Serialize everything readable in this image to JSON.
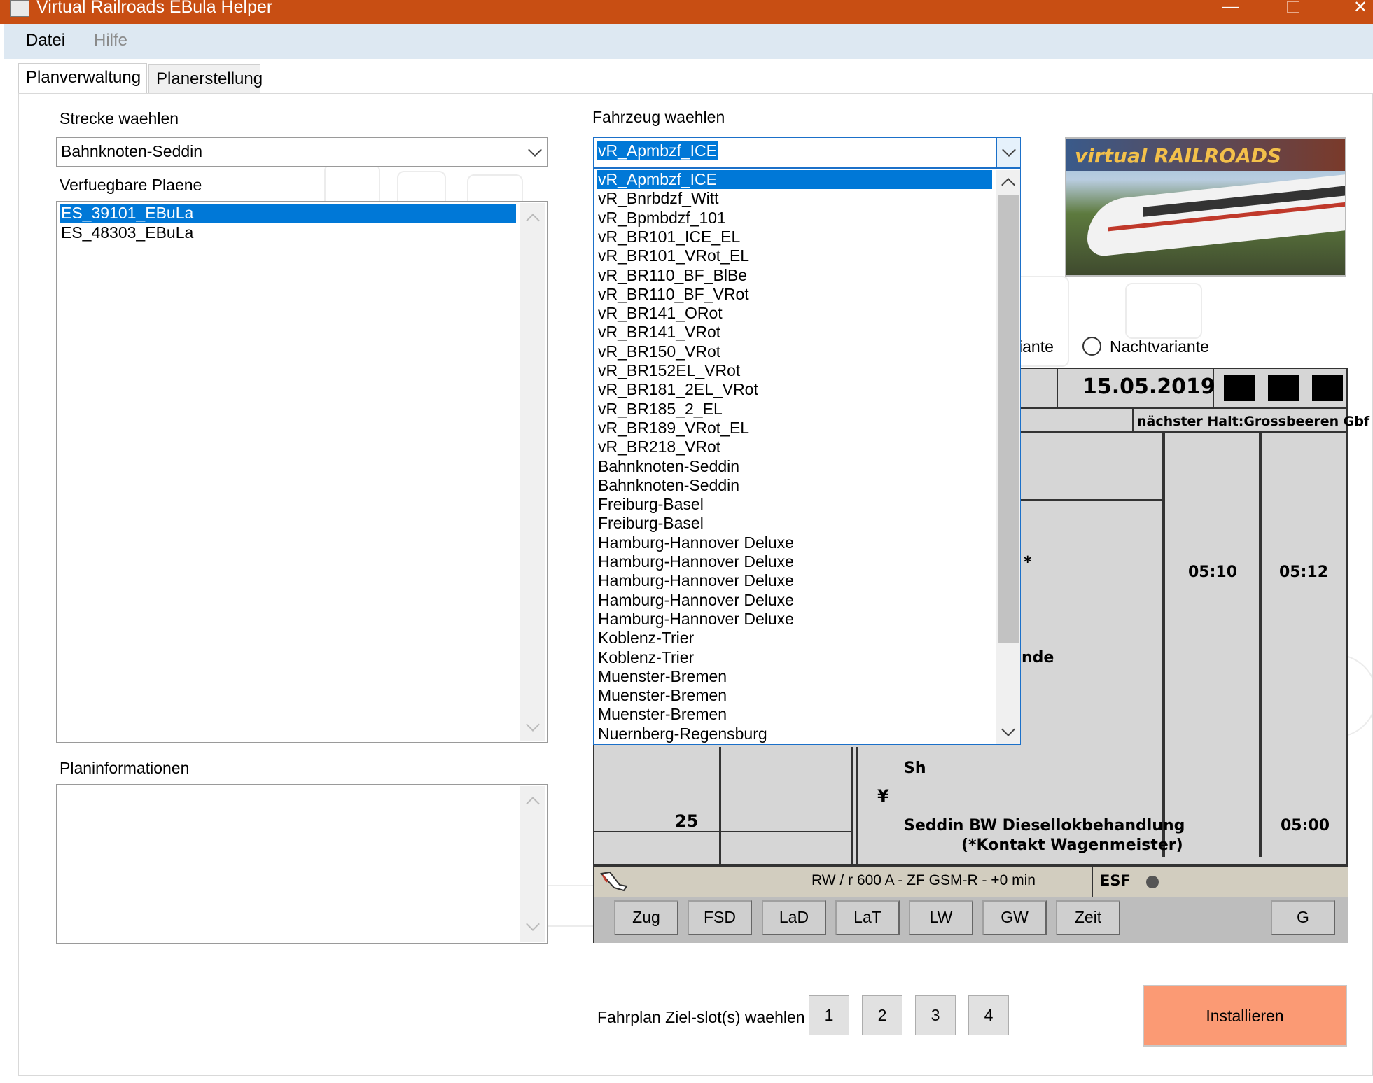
{
  "window": {
    "title": "Virtual Railroads EBula Helper",
    "minimize": "—",
    "close": "✕"
  },
  "menu": {
    "datei": "Datei",
    "hilfe": "Hilfe"
  },
  "tabs": {
    "planverwaltung": "Planverwaltung",
    "planerstellung": "Planerstellung"
  },
  "strecke": {
    "label": "Strecke waehlen",
    "value": "Bahnknoten-Seddin"
  },
  "plaene": {
    "label": "Verfuegbare Plaene",
    "items": [
      "ES_39101_EBuLa",
      "ES_48303_EBuLa"
    ]
  },
  "planinfo": {
    "label": "Planinformationen"
  },
  "fahrzeug": {
    "label": "Fahrzeug waehlen",
    "value": "vR_Apmbzf_ICE",
    "options": [
      "vR_Apmbzf_ICE",
      "vR_Bnrbdzf_Witt",
      "vR_Bpmbdzf_101",
      "vR_BR101_ICE_EL",
      "vR_BR101_VRot_EL",
      "vR_BR110_BF_BlBe",
      "vR_BR110_BF_VRot",
      "vR_BR141_ORot",
      "vR_BR141_VRot",
      "vR_BR150_VRot",
      "vR_BR152EL_VRot",
      "vR_BR181_2EL_VRot",
      "vR_BR185_2_EL",
      "vR_BR189_VRot_EL",
      "vR_BR218_VRot",
      "Bahnknoten-Seddin",
      "Bahnknoten-Seddin",
      "Freiburg-Basel",
      "Freiburg-Basel",
      "Hamburg-Hannover Deluxe",
      "Hamburg-Hannover Deluxe",
      "Hamburg-Hannover Deluxe",
      "Hamburg-Hannover Deluxe",
      "Hamburg-Hannover Deluxe",
      "Koblenz-Trier",
      "Koblenz-Trier",
      "Muenster-Bremen",
      "Muenster-Bremen",
      "Muenster-Bremen",
      "Nuernberg-Regensburg"
    ]
  },
  "logo": {
    "text": "virtual RAILROADS"
  },
  "variante": {
    "tag_partial": "iante",
    "nacht": "Nachtvariante"
  },
  "ebula": {
    "date": "15.05.2019",
    "next_stop": "nächster Halt:Grossbeeren Gbf",
    "time1": "05:10",
    "time2": "05:12",
    "star": "*",
    "partial_nde": "nde",
    "sh": "Sh",
    "yen": "¥",
    "km": "25",
    "station_line1": "Seddin BW Diesellokbehandlung",
    "station_line2": "(*Kontakt Wagenmeister)",
    "time3": "05:00",
    "status": "RW / r   600 A   - ZF GSM-R -   +0 min",
    "esf": "ESF",
    "buttons": [
      "Zug",
      "FSD",
      "LaD",
      "LaT",
      "LW",
      "GW",
      "Zeit",
      "G"
    ]
  },
  "slots": {
    "label": "Fahrplan Ziel-slot(s) waehlen",
    "items": [
      "1",
      "2",
      "3",
      "4"
    ]
  },
  "install": "Installieren"
}
